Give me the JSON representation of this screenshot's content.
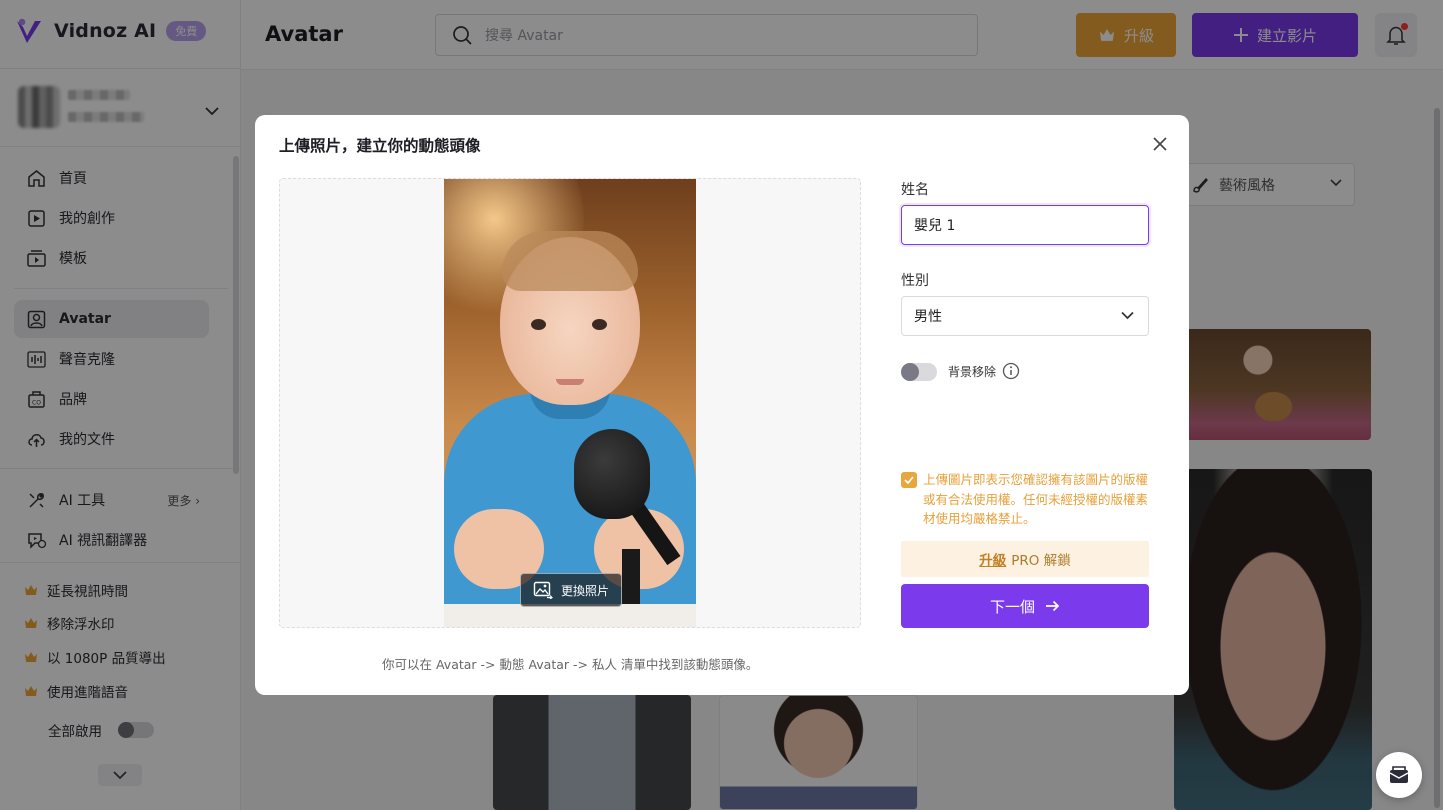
{
  "app": {
    "brand": "Vidnoz AI",
    "plan_badge": "免費"
  },
  "header": {
    "title": "Avatar",
    "search_placeholder": "搜尋 Avatar",
    "upgrade_label": "升級",
    "create_label": "建立影片"
  },
  "sidebar": {
    "nav": [
      {
        "label": "首頁",
        "icon": "home-icon"
      },
      {
        "label": "我的創作",
        "icon": "play-folder-icon"
      },
      {
        "label": "模板",
        "icon": "template-icon"
      },
      {
        "label": "Avatar",
        "icon": "avatar-icon"
      },
      {
        "label": "聲音克隆",
        "icon": "voice-wave-icon"
      },
      {
        "label": "品牌",
        "icon": "brand-kit-icon"
      },
      {
        "label": "我的文件",
        "icon": "cloud-upload-icon"
      }
    ],
    "tools": [
      {
        "label": "AI 工具",
        "icon": "tools-icon"
      },
      {
        "label": "AI 視訊翻譯器",
        "icon": "translate-icon"
      }
    ],
    "more_label": "更多",
    "perks": [
      "延長視訊時間",
      "移除浮水印",
      "以 1080P 品質導出",
      "使用進階語音"
    ],
    "enable_all_label": "全部啟用"
  },
  "filters": {
    "art_style_label": "藝術風格"
  },
  "modal": {
    "title": "上傳照片，建立你的動態頭像",
    "change_photo_label": "更換照片",
    "hint": "你可以在 Avatar -> 動態 Avatar -> 私人 清單中找到該動態頭像。",
    "name_label": "姓名",
    "name_value": "嬰兒 1",
    "gender_label": "性別",
    "gender_value": "男性",
    "bg_remove_label": "背景移除",
    "consent_text": "上傳圖片即表示您確認擁有該圖片的版權或有合法使用權。任何未經授權的版權素材使用均嚴格禁止。",
    "pro_upgrade": "升級",
    "pro_unlock": "PRO 解鎖",
    "next_label": "下一個"
  },
  "colors": {
    "accent": "#7c3aed",
    "upgrade": "#f0a63a",
    "consent": "#e7a03a"
  }
}
